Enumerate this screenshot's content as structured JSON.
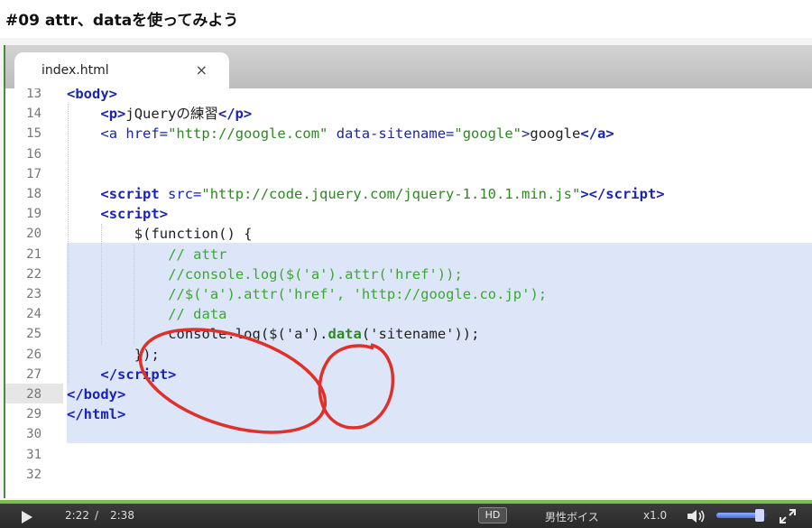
{
  "page": {
    "title": "#09 attr、dataを使ってみよう"
  },
  "editor": {
    "tab": {
      "title": "index.html",
      "close": "×"
    },
    "lines": [
      {
        "n": "13",
        "html": "<span class=\"tag\">&lt;body&gt;</span>",
        "indent": 0
      },
      {
        "n": "14",
        "html": "<span class=\"tag\">&lt;p&gt;</span><span class=\"pln\">jQueryの練習</span><span class=\"tag\">&lt;/p&gt;</span>",
        "indent": 1
      },
      {
        "n": "15",
        "html": "<span class=\"tagb\">&lt;a </span><span class=\"attr\">href=</span><span class=\"str\">\"http://google.com\"</span><span class=\"attr\"> data-sitename=</span><span class=\"str\">\"google\"</span><span class=\"tagb\">&gt;</span><span class=\"pln\">google</span><span class=\"tag\">&lt;/a&gt;</span>",
        "indent": 1
      },
      {
        "n": "16",
        "html": "",
        "indent": 0
      },
      {
        "n": "17",
        "html": "",
        "indent": 0
      },
      {
        "n": "18",
        "html": "<span class=\"tag\">&lt;script </span><span class=\"attr\">src=</span><span class=\"str\">\"http://code.jquery.com/jquery-1.10.1.min.js\"</span><span class=\"tag\">&gt;&lt;/script&gt;</span>",
        "indent": 1
      },
      {
        "n": "19",
        "html": "<span class=\"tag\">&lt;script&gt;</span>",
        "indent": 1
      },
      {
        "n": "20",
        "html": "<span class=\"pln\">$(function() {</span>",
        "indent": 2
      },
      {
        "n": "21",
        "html": "<span class=\"cmt\">// attr</span>",
        "indent": 3
      },
      {
        "n": "22",
        "html": "<span class=\"cmt\">//console.log($('a').attr('href'));</span>",
        "indent": 3
      },
      {
        "n": "23",
        "html": "<span class=\"cmt\">//$('a').attr('href', 'http://google.co.jp');</span>",
        "indent": 3
      },
      {
        "n": "24",
        "html": "<span class=\"cmt\">// data</span>",
        "indent": 3
      },
      {
        "n": "25",
        "html": "<span class=\"pln\">console.log($('a').</span><span class=\"fn\">data</span><span class=\"pln\">('sitename'));</span>",
        "indent": 3
      },
      {
        "n": "26",
        "html": "<span class=\"pln\">});</span>",
        "indent": 2
      },
      {
        "n": "27",
        "html": "<span class=\"tag\">&lt;/script&gt;</span>",
        "indent": 1
      },
      {
        "n": "28",
        "html": "<span class=\"tag\">&lt;/body&gt;</span>",
        "indent": 0
      },
      {
        "n": "29",
        "html": "<span class=\"tag\">&lt;/html&gt;</span>",
        "indent": 0
      },
      {
        "n": "30",
        "html": "",
        "indent": 0
      },
      {
        "n": "31",
        "html": "",
        "indent": 0
      },
      {
        "n": "32",
        "html": "",
        "indent": 0
      }
    ]
  },
  "controls": {
    "play_icon": "play-icon",
    "current_time": "2:22",
    "separator": "/",
    "duration": "2:38",
    "hd_label": "HD",
    "voice_label": "男性ボイス",
    "speed_label": "x1.0",
    "volume_level": 0.85,
    "volume_icon": "volume-icon",
    "fullscreen_icon": "fullscreen-icon"
  },
  "colors": {
    "progress": "#7bbf4c",
    "tag": "#1a24b5",
    "string": "#2b8a1f",
    "selection": "#dde6f8",
    "annotation": "#e0302a"
  }
}
